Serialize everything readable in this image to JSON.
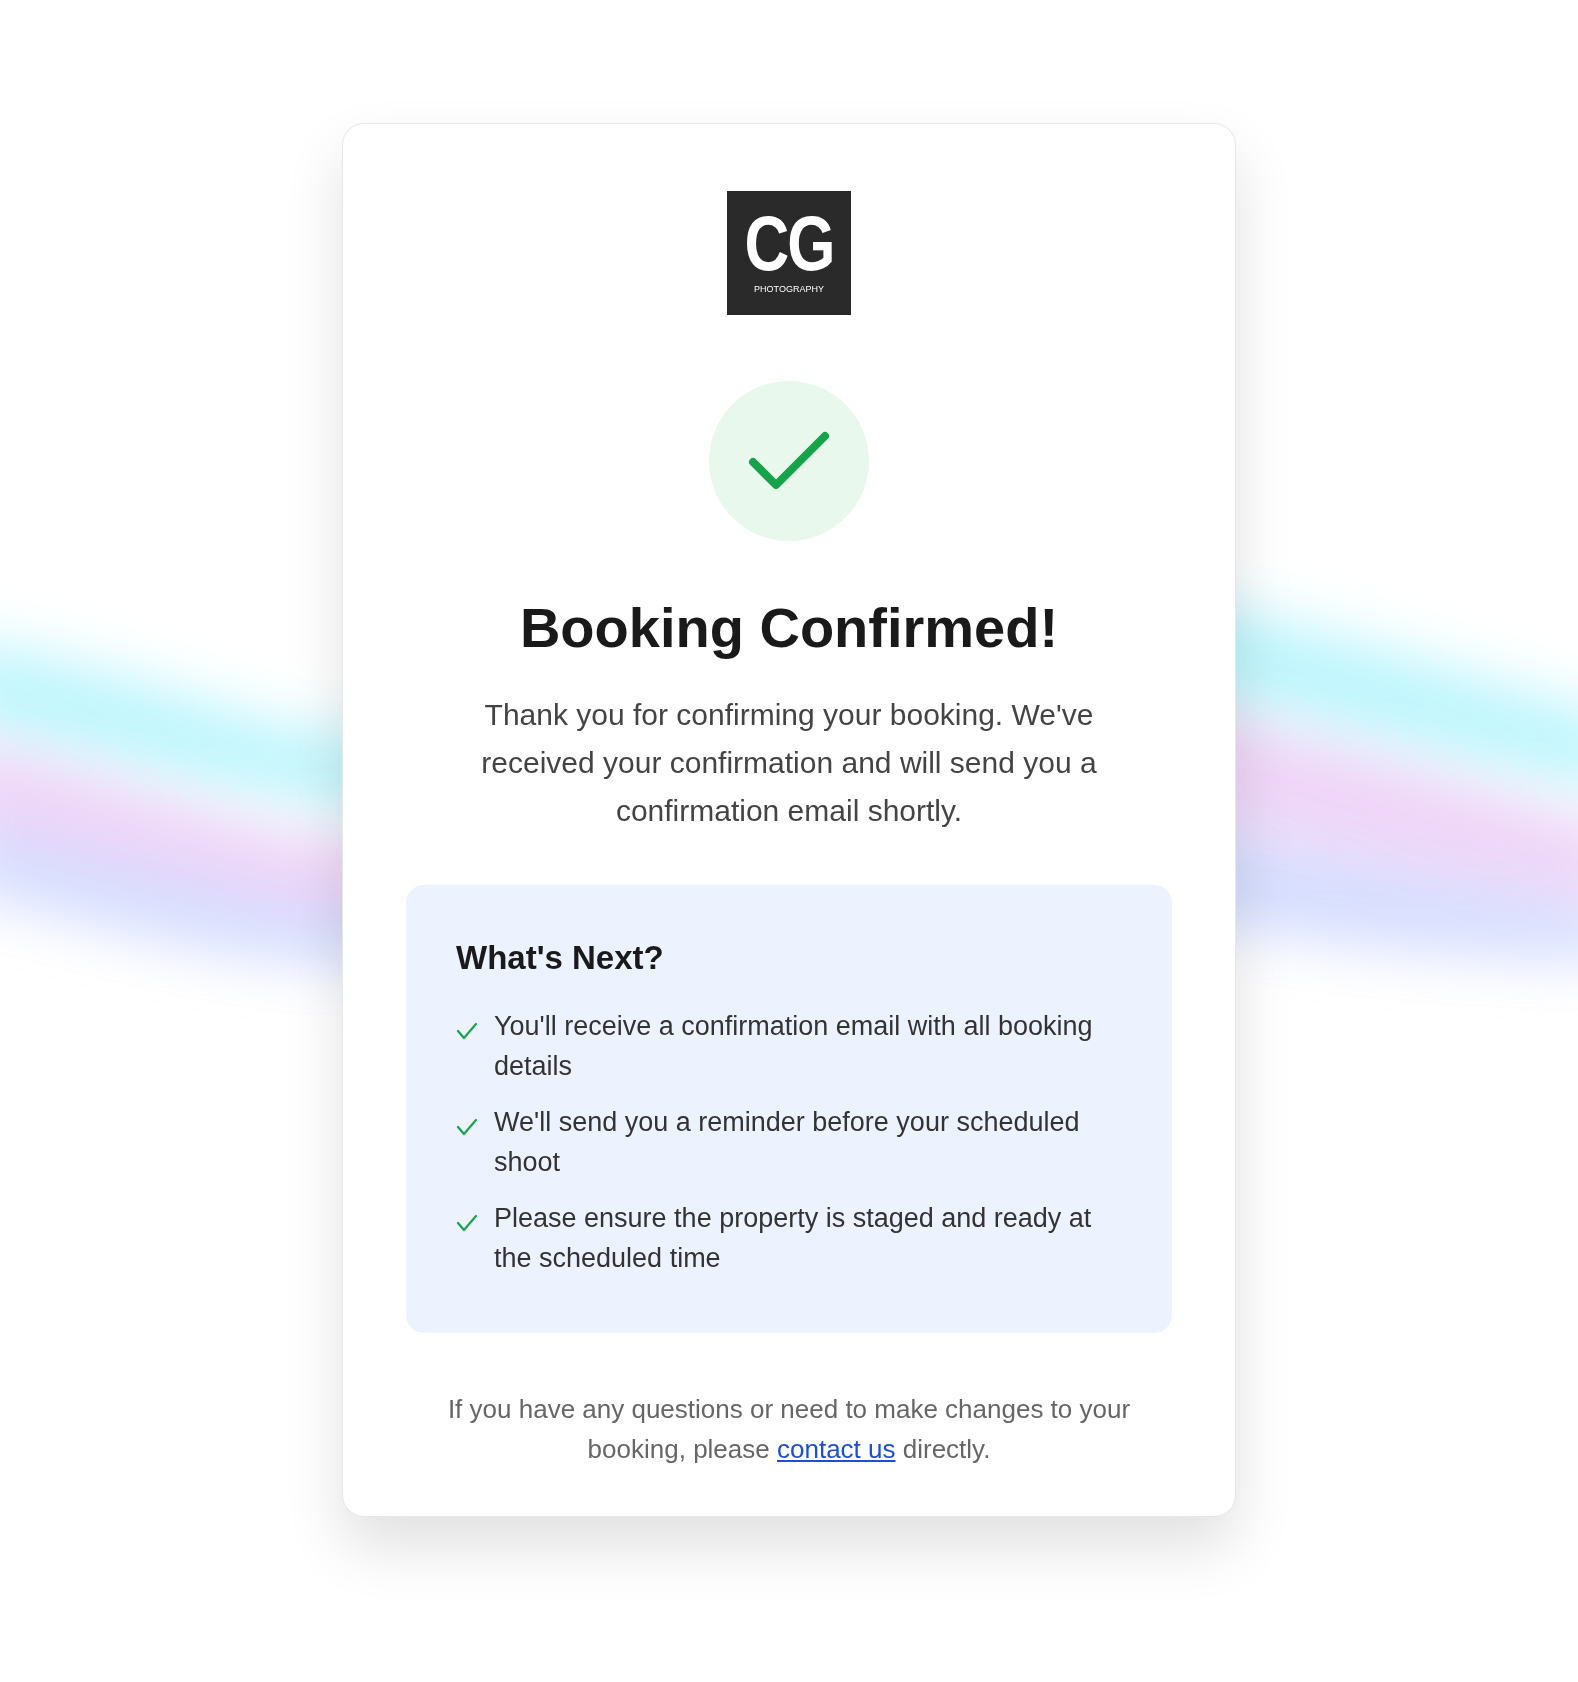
{
  "logo": {
    "initials": "CG",
    "subtitle": "PHOTOGRAPHY"
  },
  "title": "Booking Confirmed!",
  "message": "Thank you for confirming your booking. We've received your confirmation and will send you a confirmation email shortly.",
  "next": {
    "heading": "What's Next?",
    "items": [
      {
        "text": "You'll receive a confirmation email with all booking details"
      },
      {
        "text": "We'll send you a reminder before your scheduled shoot"
      },
      {
        "text": "Please ensure the property is staged and ready at the scheduled time"
      }
    ]
  },
  "footer": {
    "before": "If you have any questions or need to make changes to your booking, please",
    "link": "contact us",
    "after": "directly."
  }
}
